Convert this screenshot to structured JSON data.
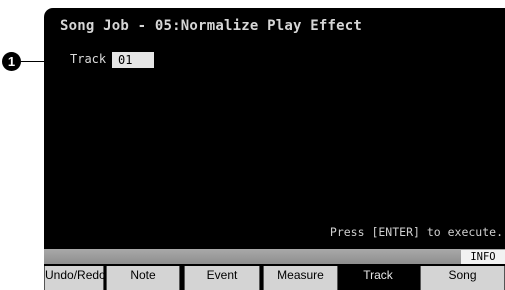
{
  "callout": {
    "number": "1"
  },
  "screen": {
    "title": "Song Job - 05:Normalize Play Effect",
    "track_label": "Track",
    "track_value": "01",
    "hint": "Press [ENTER] to execute.",
    "info_button": "INFO"
  },
  "tabs": [
    {
      "label": "Undo/Redo",
      "active": false
    },
    {
      "label": "Note",
      "active": false
    },
    {
      "label": "Event",
      "active": false
    },
    {
      "label": "Measure",
      "active": false
    },
    {
      "label": "Track",
      "active": true
    },
    {
      "label": "Song",
      "active": false
    }
  ],
  "colors": {
    "screen_bg": "#000000",
    "active_tab_text": "#e8e8e8",
    "inactive_tab": "#d4d4d4"
  }
}
